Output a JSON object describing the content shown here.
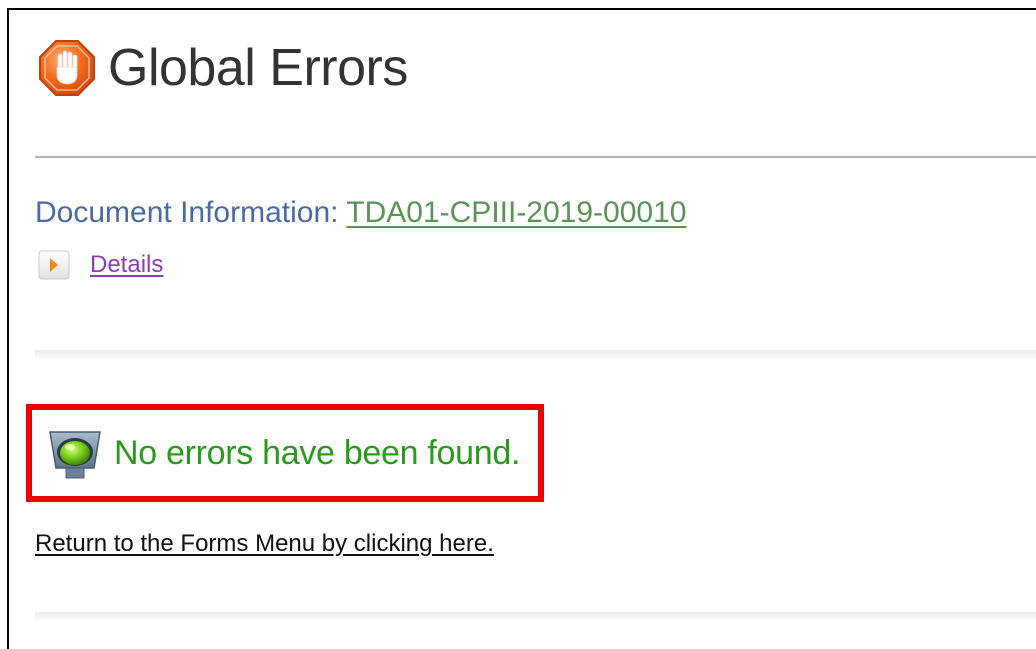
{
  "header": {
    "title": "Global Errors",
    "icon": "stop-hand-icon"
  },
  "document": {
    "label": "Document Information:",
    "id_link": "TDA01-CPIII-2019-00010"
  },
  "details": {
    "icon": "expand-arrow-icon",
    "label": "Details"
  },
  "status": {
    "icon": "green-light-icon",
    "message": "No errors have been found.",
    "highlight_color": "#ee0000",
    "text_color": "#2a9a1e"
  },
  "footer": {
    "return_link": "Return to the Forms Menu by clicking here."
  },
  "colors": {
    "label_blue": "#4a6aa5",
    "link_green": "#5a9457",
    "link_purple": "#8a3cb5"
  }
}
